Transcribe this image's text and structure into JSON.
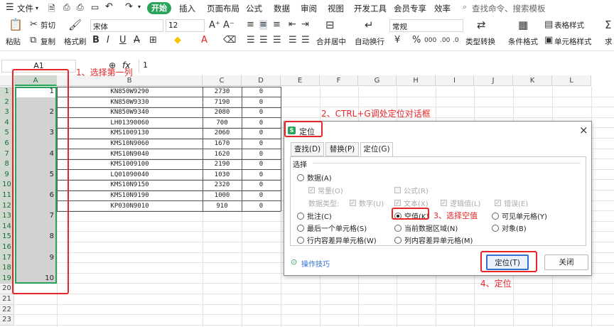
{
  "menu": {
    "file": "文件",
    "start": "开始",
    "insert": "插入",
    "layout": "页面布局",
    "formula": "公式",
    "data": "数据",
    "review": "审阅",
    "view": "视图",
    "devtools": "开发工具",
    "member": "会员专享",
    "efficiency": "效率",
    "search": "查找命令、搜索模板"
  },
  "ribbon": {
    "paste": "粘贴",
    "cut": "剪切",
    "copy": "复制",
    "format_painter": "格式刷",
    "font": "宋体",
    "size": "12",
    "merge": "合并居中",
    "wrap": "自动换行",
    "numfmt": "常规",
    "convert": "类型转换",
    "cond_format": "条件格式",
    "table_style": "表格样式",
    "cell_style": "单元格样式",
    "sum": "求"
  },
  "formula_bar": {
    "cell_ref": "A1",
    "fx": "fx",
    "value": "1"
  },
  "columns": [
    "A",
    "B",
    "C",
    "D",
    "E",
    "F",
    "G",
    "H",
    "I",
    "J",
    "K",
    "L"
  ],
  "rows": [
    "1",
    "2",
    "3",
    "4",
    "5",
    "6",
    "7",
    "8",
    "9",
    "10",
    "11",
    "12",
    "13",
    "14",
    "15",
    "16",
    "17",
    "18",
    "19",
    "20",
    "21",
    "22",
    "23"
  ],
  "col_a_values": [
    "1",
    "2",
    "3",
    "4",
    "5",
    "6",
    "7",
    "8",
    "9",
    "10"
  ],
  "table": [
    {
      "b": "KN850W9290",
      "c": "2730",
      "d": "0"
    },
    {
      "b": "KN850W9330",
      "c": "7190",
      "d": "0"
    },
    {
      "b": "KN850W9340",
      "c": "2080",
      "d": "0"
    },
    {
      "b": "LH01390060",
      "c": "700",
      "d": "0"
    },
    {
      "b": "KMS1009130",
      "c": "2060",
      "d": "0"
    },
    {
      "b": "KMS10N9060",
      "c": "1670",
      "d": "0"
    },
    {
      "b": "KMS10N9040",
      "c": "1620",
      "d": "0"
    },
    {
      "b": "KMS1009100",
      "c": "2190",
      "d": "0"
    },
    {
      "b": "LQ01090040",
      "c": "1030",
      "d": "0"
    },
    {
      "b": "KMS10N9150",
      "c": "2320",
      "d": "0"
    },
    {
      "b": "KMS10N9190",
      "c": "1000",
      "d": "0"
    },
    {
      "b": "KP030N9010",
      "c": "910",
      "d": "0"
    }
  ],
  "annotations": {
    "a1": "1、选择第一列",
    "a2": "2、CTRL+G调处定位对话框",
    "a3": "3、选择空值",
    "a4": "4、定位"
  },
  "dialog": {
    "title": "定位",
    "close": "×",
    "tabs": [
      "查找(D)",
      "替换(P)",
      "定位(G)"
    ],
    "section": "选择",
    "data": "数据(A)",
    "const": "常量(O)",
    "formula": "公式(R)",
    "datatype": "数据类型:",
    "number": "数字(U)",
    "text": "文本(X)",
    "logic": "逻辑值(L)",
    "error": "错误(E)",
    "comment": "批注(C)",
    "blank": "空值(K)",
    "visible": "可见单元格(Y)",
    "last": "最后一个单元格(S)",
    "region": "当前数据区域(N)",
    "object": "对象(B)",
    "rowdiff": "行内容差异单元格(W)",
    "coldiff": "列内容差异单元格(M)",
    "tips": "操作技巧",
    "ok": "定位(T)",
    "close_btn": "关闭"
  },
  "colors": {
    "accent": "#2aa45b",
    "red": "#e8262a",
    "select": "#217346"
  }
}
